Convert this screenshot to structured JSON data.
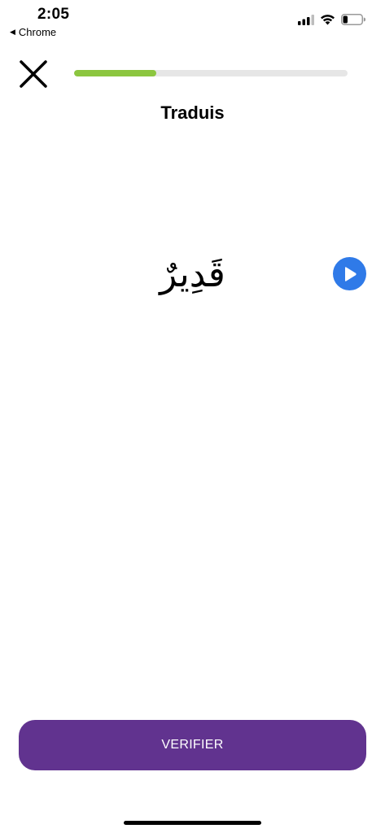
{
  "status_bar": {
    "time": "2:05",
    "back_app": "Chrome",
    "back_arrow_icon": "back-triangle-icon",
    "signal_icon": "cellular-signal-icon",
    "wifi_icon": "wifi-icon",
    "battery_icon": "battery-icon",
    "battery_level": 0.25
  },
  "top_bar": {
    "close_icon": "close-icon",
    "progress": 0.3,
    "progress_color": "#8cc63f",
    "track_color": "#e6e6e6"
  },
  "exercise": {
    "title": "Traduis",
    "word": "قَدِيرٌ",
    "play_icon": "play-icon",
    "play_color": "#2f7ae8"
  },
  "footer": {
    "verify_label": "VERIFIER",
    "verify_color": "#61338f"
  }
}
